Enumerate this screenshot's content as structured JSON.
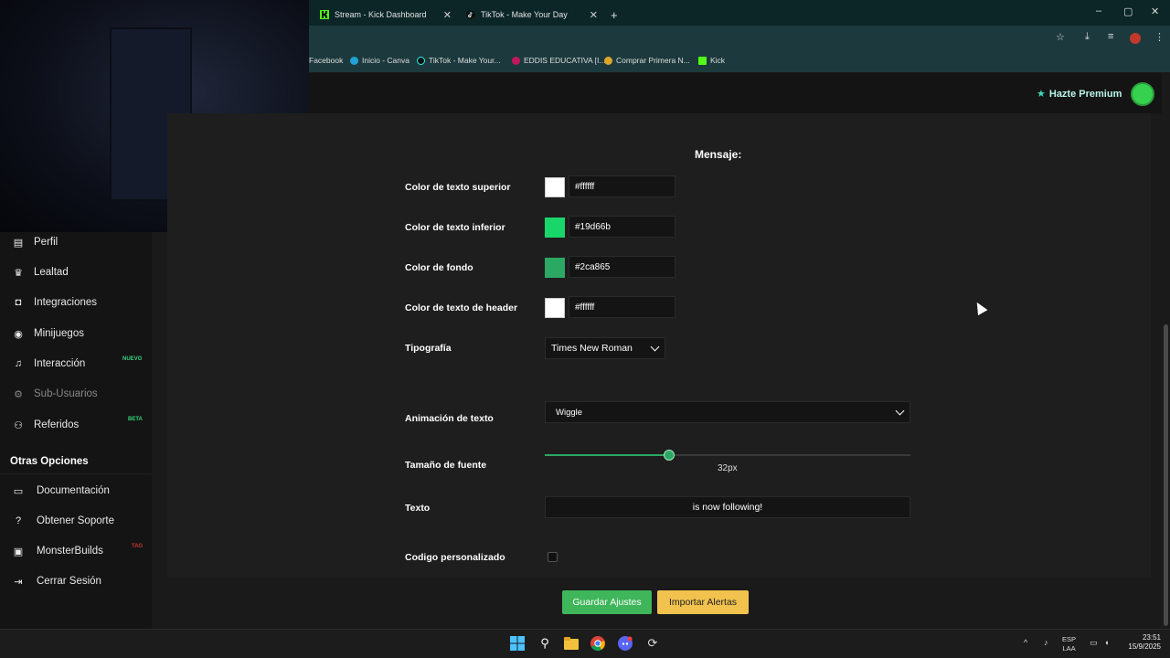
{
  "browser": {
    "tabs": [
      {
        "label": "Stream - Kick Dashboard",
        "icon": "kick-icon"
      },
      {
        "label": "TikTok - Make Your Day",
        "icon": "tiktok-icon"
      }
    ],
    "new_tab": "+",
    "window_controls": [
      "–",
      "▢",
      "✕"
    ],
    "bookmarks": [
      {
        "label": "Facebook",
        "icon": "facebook-icon"
      },
      {
        "label": "Inicio - Canva",
        "icon": "canva-icon"
      },
      {
        "label": "TikTok - Make Your...",
        "icon": "tiktok-icon"
      },
      {
        "label": "EDDIS EDUCATIVA [I...",
        "icon": "eddis-icon"
      },
      {
        "label": "Comprar Primera N...",
        "icon": "shop-icon"
      },
      {
        "label": "Kick",
        "icon": "kick-icon"
      }
    ]
  },
  "header": {
    "premium_label": "Hazte Premium",
    "premium_icon": "star-icon"
  },
  "sidebar": {
    "items": [
      {
        "label": "Perfil",
        "icon": "id-card-icon"
      },
      {
        "label": "Lealtad",
        "icon": "trophy-icon"
      },
      {
        "label": "Integraciones",
        "icon": "plug-icon"
      },
      {
        "label": "Minijuegos",
        "icon": "gamepad-icon"
      },
      {
        "label": "Interacción",
        "icon": "music-icon",
        "badge": "NUEVO"
      },
      {
        "label": "Sub-Usuarios",
        "icon": "gear-icon",
        "disabled": true
      },
      {
        "label": "Referidos",
        "icon": "users-icon",
        "badge": "BETA"
      }
    ],
    "other_section_title": "Otras Opciones",
    "other_items": [
      {
        "label": "Documentación",
        "icon": "book-icon"
      },
      {
        "label": "Obtener Soporte",
        "icon": "help-icon"
      },
      {
        "label": "MonsterBuilds",
        "icon": "laptop-icon",
        "badge": "TAG"
      },
      {
        "label": "Cerrar Sesión",
        "icon": "logout-icon"
      }
    ]
  },
  "form": {
    "section_title": "Mensaje:",
    "colors": [
      {
        "label": "Color de texto superior",
        "value": "#ffffff",
        "swatch": "#ffffff"
      },
      {
        "label": "Color de texto inferior",
        "value": "#19d66b",
        "swatch": "#19d66b"
      },
      {
        "label": "Color de fondo",
        "value": "#2ca865",
        "swatch": "#2ca865"
      },
      {
        "label": "Color de texto de header",
        "value": "#ffffff",
        "swatch": "#ffffff"
      }
    ],
    "font_label": "Tipografía",
    "font_value": "Times New Roman",
    "animation_label": "Animación de texto",
    "animation_value": "Wiggle",
    "size_label": "Tamaño de fuente",
    "size_value": "32px",
    "size_fraction": 0.34,
    "text_label": "Texto",
    "text_value": "is now following!",
    "custom_code_label": "Codigo personalizado",
    "custom_code_checked": false
  },
  "actions": {
    "save_label": "Guardar Ajustes",
    "import_label": "Importar Alertas"
  },
  "taskbar": {
    "lang_top": "ESP",
    "lang_bottom": "LAA",
    "time": "23:51",
    "date": "15/9/2025"
  },
  "theme": {
    "accent_green": "#3fb65a",
    "accent_yellow": "#f1c24d",
    "badge_new": "#34d17a",
    "badge_beta": "#34d17a",
    "badge_tag": "#c0392b"
  }
}
